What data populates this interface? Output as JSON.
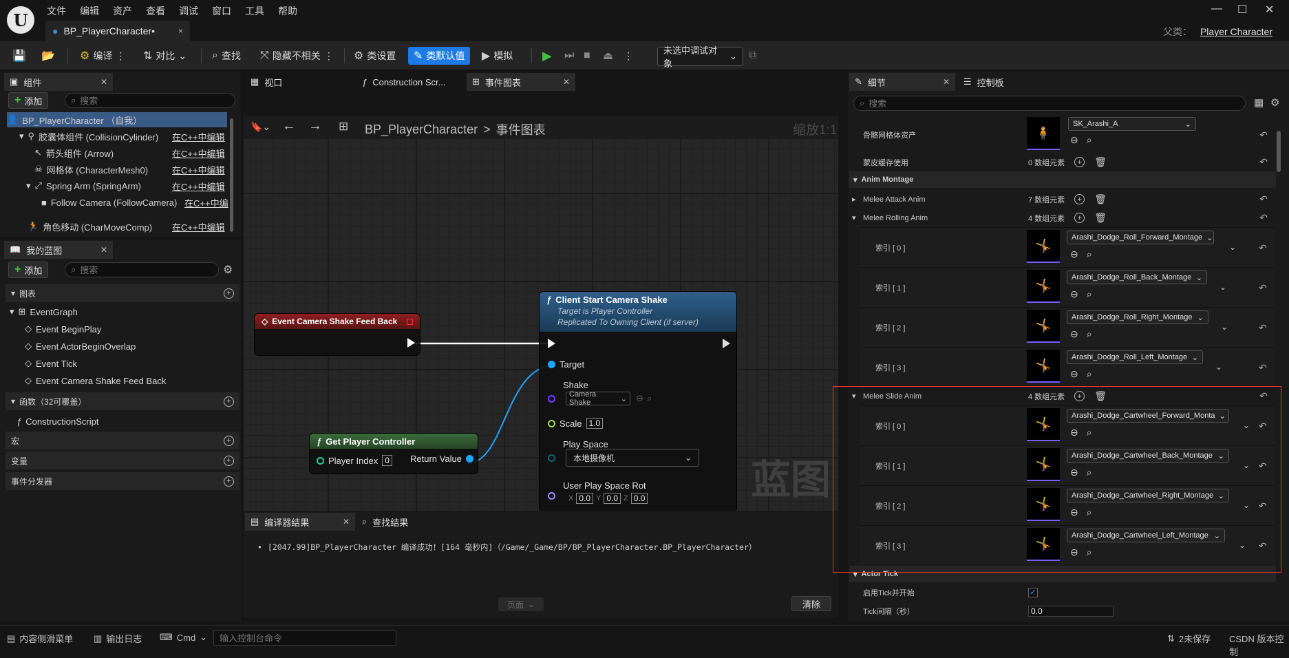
{
  "menu": [
    "文件",
    "编辑",
    "资产",
    "查看",
    "调试",
    "窗口",
    "工具",
    "帮助"
  ],
  "doc_tab": {
    "title": "BP_PlayerCharacter•",
    "close": "×"
  },
  "parent": {
    "label": "父类：",
    "value": "Player Character"
  },
  "window_controls": {
    "minimize": "—",
    "maximize": "☐",
    "close": "✕"
  },
  "toolbar": {
    "compile": "编译",
    "diff": "对比",
    "find": "查找",
    "hide_unrelated": "隐藏不相关",
    "class_settings": "类设置",
    "class_defaults": "类默认值",
    "simulate": "模拟",
    "debug_target": "未选中调试对象"
  },
  "components": {
    "tab": "组件",
    "add": "添加",
    "search_placeholder": "搜索",
    "items": [
      {
        "label": "BP_PlayerCharacter （自我）",
        "link": ""
      },
      {
        "label": "胶囊体组件 (CollisionCylinder)",
        "link": "在C++中编辑"
      },
      {
        "label": "箭头组件 (Arrow)",
        "link": "在C++中编辑"
      },
      {
        "label": "网格体 (CharacterMesh0)",
        "link": "在C++中编辑"
      },
      {
        "label": "Spring Arm (SpringArm)",
        "link": "在C++中编辑"
      },
      {
        "label": "Follow Camera (FollowCamera)",
        "link": "在C++中编"
      },
      {
        "label": "角色移动 (CharMoveComp)",
        "link": "在C++中编辑"
      }
    ]
  },
  "my_blueprint": {
    "tab": "我的蓝图",
    "add": "添加",
    "search_placeholder": "搜索",
    "graphs_label": "图表",
    "event_graph": "EventGraph",
    "events": [
      "Event BeginPlay",
      "Event ActorBeginOverlap",
      "Event Tick",
      "Event Camera Shake Feed Back"
    ],
    "functions_label": "函数（32可覆盖）",
    "construction": "ConstructionScript",
    "macros": "宏",
    "variables": "变量",
    "dispatchers": "事件分发器"
  },
  "editor_tabs": [
    "视口",
    "Construction Scr...",
    "事件图表"
  ],
  "breadcrumb": {
    "bp": "BP_PlayerCharacter",
    "sep": ">",
    "graph": "事件图表",
    "zoom": "缩放1:1"
  },
  "watermark": "蓝图",
  "nodes": {
    "event": {
      "title": "Event Camera Shake Feed Back"
    },
    "client": {
      "title": "Client Start Camera Shake",
      "sub1": "Target is Player Controller",
      "sub2": "Replicated To Owning Client (if server)",
      "target": "Target",
      "shake": "Shake",
      "shake_value": "Camera Shake",
      "scale": "Scale",
      "scale_value": "1.0",
      "play_space": "Play Space",
      "play_space_value": "本地摄像机",
      "rot": "User Play Space Rot",
      "x": "0.0",
      "y": "0.0",
      "z": "0.0"
    },
    "getpc": {
      "title": "Get Player Controller",
      "player_index": "Player Index",
      "index_value": "0",
      "return": "Return Value"
    }
  },
  "bottom": {
    "tab1": "编译器结果",
    "tab2": "查找结果",
    "log": "[2047.99]BP_PlayerCharacter 编译成功！[164 毫秒内]（/Game/_Game/BP/BP_PlayerCharacter.BP_PlayerCharacter）",
    "page": "页面",
    "clear": "清除"
  },
  "status": {
    "content_drawer": "内容侧滑菜单",
    "output_log": "输出日志",
    "cmd": "Cmd",
    "console_placeholder": "输入控制台命令",
    "unsaved": "2未保存",
    "source": "CSDN 版本控制"
  },
  "details": {
    "tab1": "细节",
    "tab2": "控制板",
    "search_placeholder": "搜索",
    "skel_label": "骨骼网格体资产",
    "skel_value": "SK_Arashi_A",
    "skin_cache": "蒙皮缓存使用",
    "skin_cache_val": "0 数组元素",
    "anim_montage": "Anim Montage",
    "melee_attack": "Melee Attack Anim",
    "melee_attack_val": "7 数组元素",
    "melee_rolling": "Melee Rolling Anim",
    "melee_rolling_val": "4 数组元素",
    "rolling": [
      {
        "idx": "索引 [ 0 ]",
        "asset": "Arashi_Dodge_Roll_Forward_Montage"
      },
      {
        "idx": "索引 [ 1 ]",
        "asset": "Arashi_Dodge_Roll_Back_Montage"
      },
      {
        "idx": "索引 [ 2 ]",
        "asset": "Arashi_Dodge_Roll_Right_Montage"
      },
      {
        "idx": "索引 [ 3 ]",
        "asset": "Arashi_Dodge_Roll_Left_Montage"
      }
    ],
    "melee_slide": "Melee Slide Anim",
    "melee_slide_val": "4 数组元素",
    "slide": [
      {
        "idx": "索引 [ 0 ]",
        "asset": "Arashi_Dodge_Cartwheel_Forward_Monta"
      },
      {
        "idx": "索引 [ 1 ]",
        "asset": "Arashi_Dodge_Cartwheel_Back_Montage"
      },
      {
        "idx": "索引 [ 2 ]",
        "asset": "Arashi_Dodge_Cartwheel_Right_Montage"
      },
      {
        "idx": "索引 [ 3 ]",
        "asset": "Arashi_Dodge_Cartwheel_Left_Montage"
      }
    ],
    "actor_tick": "Actor Tick",
    "start_tick": "启用Tick并开始",
    "tick_interval": "Tick间隔（秒）",
    "tick_interval_val": "0.0"
  },
  "colors": {
    "accent": "#1d7be6",
    "highlight": "#e33333",
    "exec": "#ffffff",
    "object_pin": "#1ca5ff",
    "float_pin": "#a0e04a"
  }
}
